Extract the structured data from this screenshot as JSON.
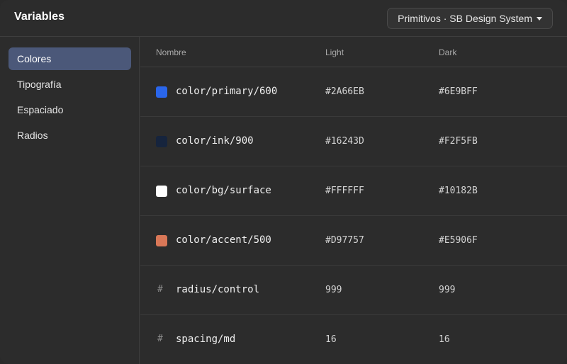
{
  "header": {
    "title": "Variables",
    "collection_label": "Primitivos · SB Design System"
  },
  "sidebar": {
    "items": [
      {
        "label": "Colores",
        "active": true
      },
      {
        "label": "Tipografía",
        "active": false
      },
      {
        "label": "Espaciado",
        "active": false
      },
      {
        "label": "Radios",
        "active": false
      }
    ]
  },
  "table": {
    "columns": {
      "name": "Nombre",
      "light": "Light",
      "dark": "Dark"
    },
    "rows": [
      {
        "type": "color",
        "icon": "color-swatch",
        "name": "color/primary/600",
        "light": "#2A66EB",
        "dark": "#6E9BFF",
        "swatch": "#2A66EB"
      },
      {
        "type": "color",
        "icon": "color-swatch",
        "name": "color/ink/900",
        "light": "#16243D",
        "dark": "#F2F5FB",
        "swatch": "#16243D"
      },
      {
        "type": "color",
        "icon": "color-swatch",
        "name": "color/bg/surface",
        "light": "#FFFFFF",
        "dark": "#10182B",
        "swatch": "#FFFFFF"
      },
      {
        "type": "color",
        "icon": "color-swatch",
        "name": "color/accent/500",
        "light": "#D97757",
        "dark": "#E5906F",
        "swatch": "#D97757"
      },
      {
        "type": "number",
        "icon": "#",
        "name": "radius/control",
        "light": "999",
        "dark": "999"
      },
      {
        "type": "number",
        "icon": "#",
        "name": "spacing/md",
        "light": "16",
        "dark": "16"
      }
    ]
  },
  "colors": {
    "window_bg": "#2C2C2C",
    "active_nav_bg": "#4B5879",
    "divider": "#3E3E3E"
  }
}
